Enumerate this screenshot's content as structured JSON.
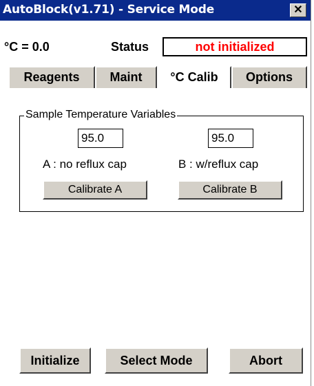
{
  "window": {
    "title": "AutoBlock(v1.71) - Service Mode",
    "close_glyph": "✕"
  },
  "header": {
    "temperature_readout": "°C = 0.0",
    "status_label": "Status",
    "status_value": "not initialized",
    "status_color": "#ff0000"
  },
  "tabs": [
    {
      "label": "Reagents",
      "active": false
    },
    {
      "label": "Maint",
      "active": false
    },
    {
      "label": "°C  Calib",
      "active": true
    },
    {
      "label": "Options",
      "active": false
    }
  ],
  "calibration": {
    "group_title": "Sample Temperature Variables",
    "a": {
      "value": "95.0",
      "label": "A : no reflux cap",
      "button": "Calibrate A"
    },
    "b": {
      "value": "95.0",
      "label": "B : w/reflux cap",
      "button": "Calibrate B"
    }
  },
  "footer": {
    "initialize_label": "Initialize",
    "select_mode_label": "Select Mode",
    "abort_label": "Abort"
  },
  "colors": {
    "titlebar": "#0a2a8c",
    "button_face": "#d4d0c8"
  }
}
